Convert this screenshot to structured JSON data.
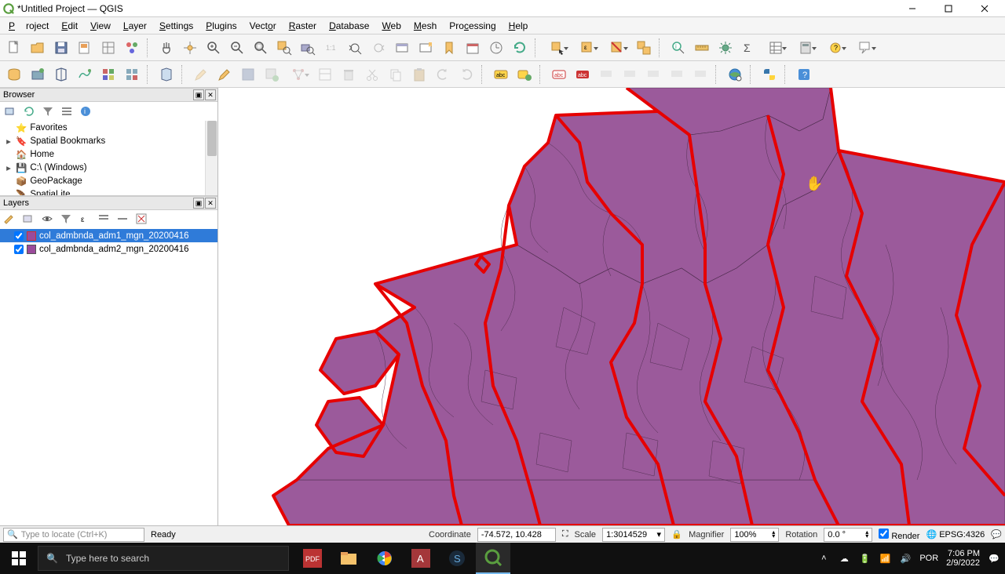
{
  "window": {
    "title": "*Untitled Project — QGIS"
  },
  "menu": {
    "project": "Project",
    "edit": "Edit",
    "view": "View",
    "layer": "Layer",
    "settings": "Settings",
    "plugins": "Plugins",
    "vector": "Vector",
    "raster": "Raster",
    "database": "Database",
    "web": "Web",
    "mesh": "Mesh",
    "processing": "Processing",
    "help": "Help"
  },
  "panels": {
    "browser": {
      "title": "Browser"
    },
    "layers": {
      "title": "Layers"
    }
  },
  "browser_items": {
    "favorites": "Favorites",
    "bookmarks": "Spatial Bookmarks",
    "home": "Home",
    "cdrive": "C:\\ (Windows)",
    "geopackage": "GeoPackage",
    "spatialite": "SpatiaLite"
  },
  "layers": [
    {
      "name": "col_admbnda_adm1_mgn_20200416"
    },
    {
      "name": "col_admbnda_adm2_mgn_20200416"
    }
  ],
  "status": {
    "locate_placeholder": "Type to locate (Ctrl+K)",
    "ready": "Ready",
    "coord_label": "Coordinate",
    "coord_value": "-74.572, 10.428",
    "scale_label": "Scale",
    "scale_value": "1:3014529",
    "magnifier_label": "Magnifier",
    "magnifier_value": "100%",
    "rotation_label": "Rotation",
    "rotation_value": "0.0 °",
    "render_label": "Render",
    "crs": "EPSG:4326"
  },
  "taskbar": {
    "search_placeholder": "Type here to search",
    "lang": "POR",
    "time": "7:06 PM",
    "date": "2/9/2022"
  }
}
